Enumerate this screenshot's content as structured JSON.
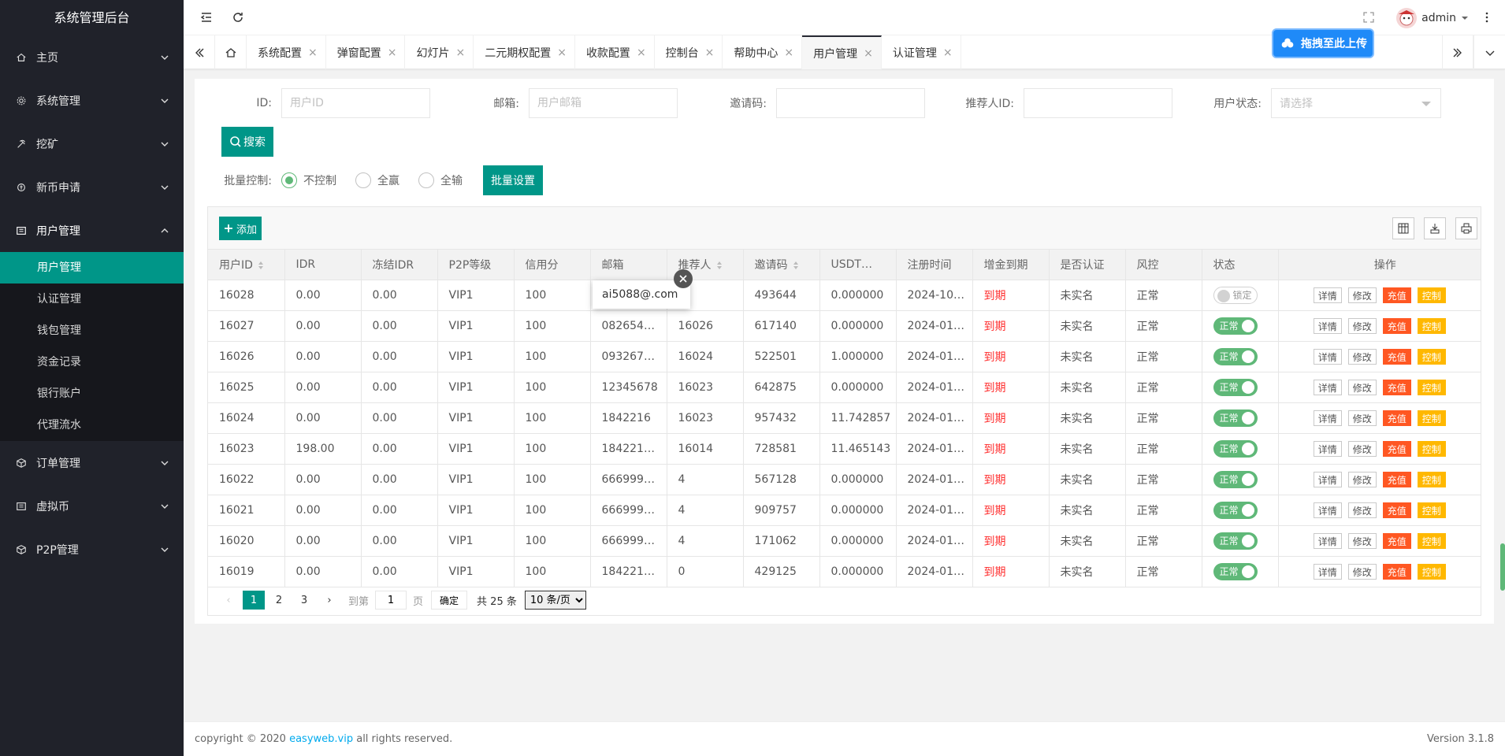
{
  "sidebar": {
    "title": "系统管理后台",
    "items": [
      {
        "label": "主页",
        "icon": "home-icon"
      },
      {
        "label": "系统管理",
        "icon": "gear-icon"
      },
      {
        "label": "挖矿",
        "icon": "mining-icon"
      },
      {
        "label": "新币申请",
        "icon": "coin-icon"
      },
      {
        "label": "用户管理",
        "icon": "users-icon",
        "expanded": true
      },
      {
        "label": "订单管理",
        "icon": "order-icon"
      },
      {
        "label": "虚拟币",
        "icon": "crypto-icon"
      },
      {
        "label": "P2P管理",
        "icon": "p2p-icon"
      }
    ],
    "sub_items": [
      "用户管理",
      "认证管理",
      "钱包管理",
      "资金记录",
      "银行账户",
      "代理流水"
    ]
  },
  "header": {
    "username": "admin"
  },
  "tabs": [
    "系统配置",
    "弹窗配置",
    "幻灯片",
    "二元期权配置",
    "收款配置",
    "控制台",
    "帮助中心",
    "用户管理",
    "认证管理"
  ],
  "upload_badge": "拖拽至此上传",
  "search": {
    "id_label": "ID:",
    "id_placeholder": "用户ID",
    "email_label": "邮箱:",
    "email_placeholder": "用户邮箱",
    "invite_label": "邀请码:",
    "invite_placeholder": "",
    "referrer_label": "推荐人ID:",
    "referrer_placeholder": "",
    "status_label": "用户状态:",
    "status_placeholder": "请选择",
    "search_button": "搜索"
  },
  "batch": {
    "label": "批量控制:",
    "options": [
      "不控制",
      "全赢",
      "全输"
    ],
    "selected": "不控制",
    "button": "批量设置"
  },
  "toolbar": {
    "add_button": "添加"
  },
  "table": {
    "headers": [
      "用户ID",
      "IDR",
      "冻结IDR",
      "P2P等级",
      "信用分",
      "邮箱",
      "推荐人",
      "邀请码",
      "USDT…",
      "注册时间",
      "增金到期",
      "是否认证",
      "风控",
      "状态",
      "操作"
    ],
    "rows": [
      [
        "16028",
        "0.00",
        "0.00",
        "VIP1",
        "100",
        "",
        "",
        "493644",
        "0.000000",
        "2024-10…",
        "到期",
        "未实名",
        "正常",
        "锁定"
      ],
      [
        "16027",
        "0.00",
        "0.00",
        "VIP1",
        "100",
        "082654…",
        "16026",
        "617140",
        "0.000000",
        "2024-01…",
        "到期",
        "未实名",
        "正常",
        "正常"
      ],
      [
        "16026",
        "0.00",
        "0.00",
        "VIP1",
        "100",
        "093267…",
        "16024",
        "522501",
        "1.000000",
        "2024-01…",
        "到期",
        "未实名",
        "正常",
        "正常"
      ],
      [
        "16025",
        "0.00",
        "0.00",
        "VIP1",
        "100",
        "12345678",
        "16023",
        "642875",
        "0.000000",
        "2024-01…",
        "到期",
        "未实名",
        "正常",
        "正常"
      ],
      [
        "16024",
        "0.00",
        "0.00",
        "VIP1",
        "100",
        "1842216",
        "16023",
        "957432",
        "11.742857",
        "2024-01…",
        "到期",
        "未实名",
        "正常",
        "正常"
      ],
      [
        "16023",
        "198.00",
        "0.00",
        "VIP1",
        "100",
        "184221…",
        "16014",
        "728581",
        "11.465143",
        "2024-01…",
        "到期",
        "未实名",
        "正常",
        "正常"
      ],
      [
        "16022",
        "0.00",
        "0.00",
        "VIP1",
        "100",
        "666999…",
        "4",
        "567128",
        "0.000000",
        "2024-01…",
        "到期",
        "未实名",
        "正常",
        "正常"
      ],
      [
        "16021",
        "0.00",
        "0.00",
        "VIP1",
        "100",
        "666999…",
        "4",
        "909757",
        "0.000000",
        "2024-01…",
        "到期",
        "未实名",
        "正常",
        "正常"
      ],
      [
        "16020",
        "0.00",
        "0.00",
        "VIP1",
        "100",
        "666999…",
        "4",
        "171062",
        "0.000000",
        "2024-01…",
        "到期",
        "未实名",
        "正常",
        "正常"
      ],
      [
        "16019",
        "0.00",
        "0.00",
        "VIP1",
        "100",
        "184221…",
        "0",
        "429125",
        "0.000000",
        "2024-01…",
        "到期",
        "未实名",
        "正常",
        "正常"
      ]
    ],
    "ops": [
      "详情",
      "修改",
      "充值",
      "控制"
    ]
  },
  "email_popup": "ai5088@.com",
  "pager": {
    "pages": [
      "1",
      "2",
      "3"
    ],
    "current": "1",
    "goto_label": "到第",
    "page_value": "1",
    "page_unit": "页",
    "confirm": "确定",
    "total": "共 25 条",
    "page_size": "10 条/页"
  },
  "footer": {
    "copyright_pre": "copyright © 2020 ",
    "link": "easyweb.vip",
    "copyright_post": " all rights reserved.",
    "version": "Version 3.1.8"
  },
  "colors": {
    "accent": "#009688",
    "sidebar_bg": "#20222a",
    "switch_on": "#5fb878",
    "op_orange": "#ff5722",
    "op_yellow": "#ffb800",
    "expired": "#ff2d2d"
  }
}
